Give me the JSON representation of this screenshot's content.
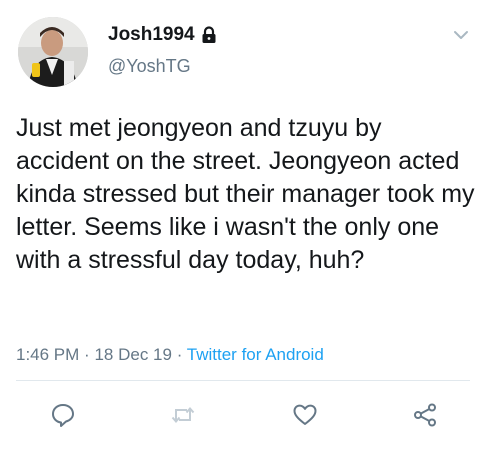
{
  "user": {
    "display_name": "Josh1994",
    "handle": "@YoshTG",
    "avatar_icon": "profile-photo",
    "protected_icon": "lock-icon"
  },
  "tweet": {
    "text": "Just met jeongyeon and tzuyu by accident on the street. Jeongyeon acted kinda stressed but their manager took my letter. Seems like i wasn't the only one with a stressful day today, huh?",
    "time": "1:46 PM",
    "separator": "·",
    "date": "18 Dec 19",
    "source": "Twitter for Android"
  },
  "actions": [
    {
      "name": "reply",
      "icon": "reply-icon"
    },
    {
      "name": "retweet",
      "icon": "retweet-icon"
    },
    {
      "name": "like",
      "icon": "heart-icon"
    },
    {
      "name": "share",
      "icon": "share-icon"
    }
  ],
  "colors": {
    "text": "#14171a",
    "secondary": "#657786",
    "link": "#1da1f2",
    "icon": "#657786",
    "divider": "#e1e8ed"
  }
}
